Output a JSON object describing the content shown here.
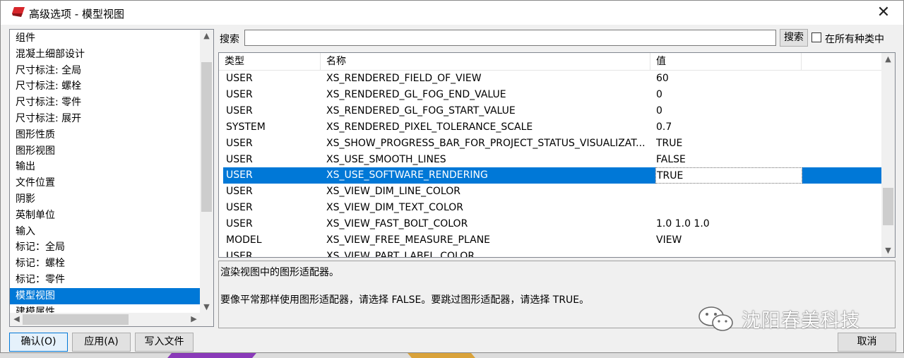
{
  "window": {
    "title": "高级选项 - 模型视图",
    "close": "✕"
  },
  "sidebar": {
    "items": [
      {
        "label": "组件"
      },
      {
        "label": "混凝土细部设计"
      },
      {
        "label": "尺寸标注: 全局"
      },
      {
        "label": "尺寸标注: 螺栓"
      },
      {
        "label": "尺寸标注: 零件"
      },
      {
        "label": "尺寸标注: 展开"
      },
      {
        "label": "图形性质"
      },
      {
        "label": "图形视图"
      },
      {
        "label": "输出"
      },
      {
        "label": "文件位置"
      },
      {
        "label": "阴影"
      },
      {
        "label": "英制单位"
      },
      {
        "label": "输入"
      },
      {
        "label": "标记：全局"
      },
      {
        "label": "标记：螺栓"
      },
      {
        "label": "标记：零件"
      },
      {
        "label": "模型视图",
        "selected": true
      },
      {
        "label": "建模属性"
      }
    ]
  },
  "search": {
    "label": "搜索",
    "value": "",
    "button": "搜索",
    "all_categories_label": "在所有种类中",
    "all_categories_checked": false
  },
  "table": {
    "headers": [
      "类型",
      "名称",
      "值"
    ],
    "rows": [
      {
        "type": "USER",
        "name": "XS_RENDERED_FIELD_OF_VIEW",
        "value": "60"
      },
      {
        "type": "USER",
        "name": "XS_RENDERED_GL_FOG_END_VALUE",
        "value": "0"
      },
      {
        "type": "USER",
        "name": "XS_RENDERED_GL_FOG_START_VALUE",
        "value": "0"
      },
      {
        "type": "SYSTEM",
        "name": "XS_RENDERED_PIXEL_TOLERANCE_SCALE",
        "value": "0.7"
      },
      {
        "type": "USER",
        "name": "XS_SHOW_PROGRESS_BAR_FOR_PROJECT_STATUS_VISUALIZAT...",
        "value": "TRUE"
      },
      {
        "type": "USER",
        "name": "XS_USE_SMOOTH_LINES",
        "value": "FALSE"
      },
      {
        "type": "USER",
        "name": "XS_USE_SOFTWARE_RENDERING",
        "value": "TRUE",
        "selected": true
      },
      {
        "type": "USER",
        "name": "XS_VIEW_DIM_LINE_COLOR",
        "value": ""
      },
      {
        "type": "USER",
        "name": "XS_VIEW_DIM_TEXT_COLOR",
        "value": ""
      },
      {
        "type": "USER",
        "name": "XS_VIEW_FAST_BOLT_COLOR",
        "value": "1.0 1.0 1.0"
      },
      {
        "type": "MODEL",
        "name": "XS_VIEW_FREE_MEASURE_PLANE",
        "value": "VIEW"
      },
      {
        "type": "USER",
        "name": "XS_VIEW_PART_LABEL_COLOR",
        "value": ""
      }
    ]
  },
  "description": {
    "line1": "渲染视图中的图形适配器。",
    "line2": "要像平常那样使用图形适配器，请选择 FALSE。要跳过图形适配器，请选择 TRUE。"
  },
  "buttons": {
    "ok": "确认(O)",
    "apply": "应用(A)",
    "import": "写入文件",
    "cancel": "取消"
  },
  "watermark": {
    "text": "沈阳春美科技",
    "icon": "wechat-icon"
  },
  "colors": {
    "selection": "#0078d7",
    "window_bg": "#f0f0f0"
  }
}
